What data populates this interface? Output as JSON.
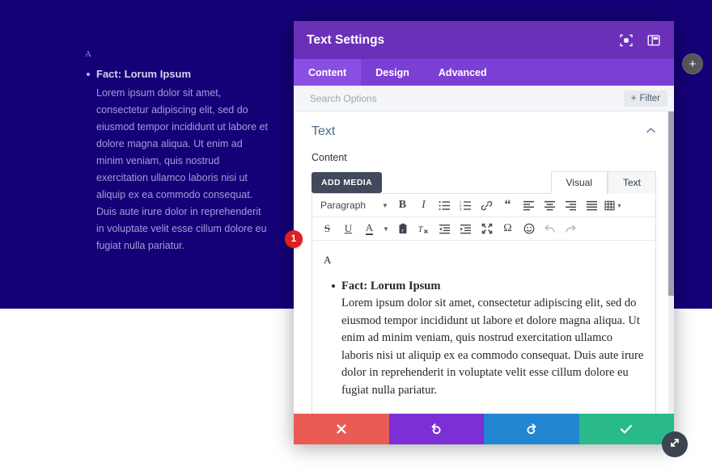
{
  "canvas": {
    "background_color": "#150077",
    "preview": {
      "letter": "A",
      "title": "Fact: Lorum Ipsum",
      "body": "Lorem ipsum dolor sit amet, consectetur adipiscing elit, sed do eiusmod tempor incididunt ut labore et dolore magna aliqua. Ut enim ad minim veniam, quis nostrud exercitation ullamco laboris nisi ut aliquip ex ea commodo consequat. Duis aute irure dolor in reprehenderit in voluptate velit esse cillum dolore eu fugiat nulla pariatur."
    },
    "add_module_label": "+"
  },
  "modal": {
    "title": "Text Settings",
    "accent_color": "#6b2fb8",
    "header_icons": [
      {
        "name": "focus-target-icon"
      },
      {
        "name": "panel-layout-icon"
      }
    ],
    "tabs": [
      {
        "label": "Content",
        "active": true
      },
      {
        "label": "Design",
        "active": false
      },
      {
        "label": "Advanced",
        "active": false
      }
    ],
    "search": {
      "placeholder": "Search Options",
      "value": "",
      "filter_label": "Filter",
      "filter_plus": "+"
    },
    "section": {
      "title": "Text",
      "collapse_chevron": "chevron-up-icon",
      "field_label": "Content"
    },
    "editor": {
      "add_media_label": "ADD MEDIA",
      "mode_tabs": [
        {
          "label": "Visual",
          "active": true
        },
        {
          "label": "Text",
          "active": false
        }
      ],
      "format_select": "Paragraph",
      "toolbar_row1": [
        "bold-icon",
        "italic-icon",
        "bulleted-list-icon",
        "numbered-list-icon",
        "link-icon",
        "blockquote-icon",
        "align-left-icon",
        "align-center-icon",
        "align-right-icon",
        "align-justify-icon",
        "table-icon"
      ],
      "toolbar_row2": [
        "strikethrough-icon",
        "underline-icon",
        "text-color-icon",
        "paste-as-text-icon",
        "clear-formatting-icon",
        "outdent-icon",
        "indent-icon",
        "fullscreen-icon",
        "special-character-icon",
        "emoji-icon",
        "undo-icon",
        "redo-icon"
      ],
      "content": {
        "letter": "A",
        "title": "Fact: Lorum Ipsum",
        "body": "Lorem ipsum dolor sit amet, consectetur adipiscing elit, sed do eiusmod tempor incididunt ut labore et dolore magna aliqua. Ut enim ad minim veniam, quis nostrud exercitation ullamco laboris nisi ut aliquip ex ea commodo consequat. Duis aute irure dolor in reprehenderit in voluptate velit esse cillum dolore eu fugiat nulla pariatur."
      }
    },
    "step_badge": "1",
    "footer_buttons": [
      {
        "name": "cancel",
        "icon": "close-x-icon",
        "color": "#eb5b56"
      },
      {
        "name": "undo",
        "icon": "undo-arrow-icon",
        "color": "#7b2fd4"
      },
      {
        "name": "redo",
        "icon": "redo-arrow-icon",
        "color": "#2286d3"
      },
      {
        "name": "save",
        "icon": "checkmark-icon",
        "color": "#2ab98a"
      }
    ]
  },
  "resize_handle": {
    "name": "resize-diagonal-icon"
  }
}
